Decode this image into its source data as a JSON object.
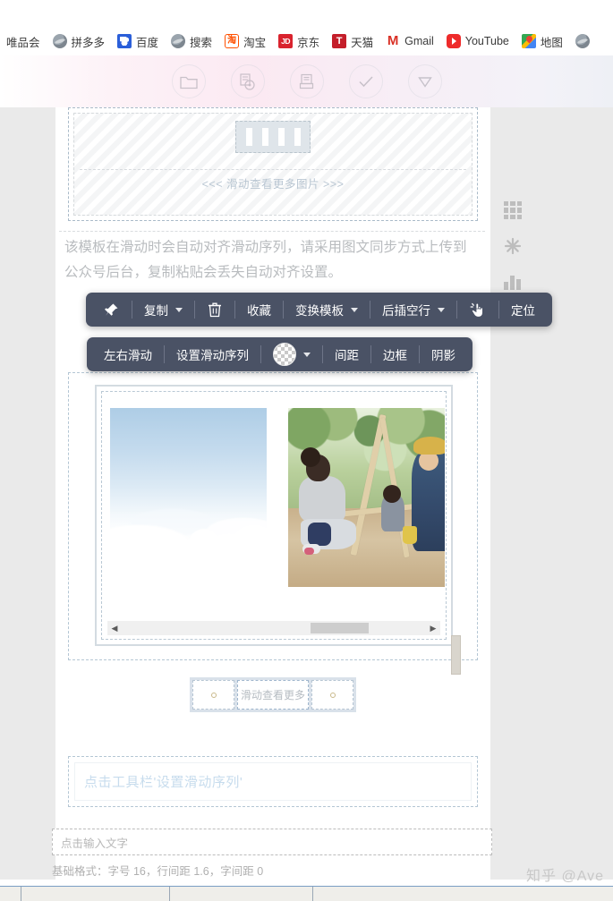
{
  "bookmarks": [
    {
      "label": "唯品会",
      "icon": "none"
    },
    {
      "label": "拼多多",
      "icon": "globe-icon"
    },
    {
      "label": "百度",
      "icon": "baidu-icon"
    },
    {
      "label": "搜索",
      "icon": "globe-icon"
    },
    {
      "label": "淘宝",
      "icon": "taobao-icon"
    },
    {
      "label": "京东",
      "icon": "jd-icon"
    },
    {
      "label": "天猫",
      "icon": "tmall-icon"
    },
    {
      "label": "Gmail",
      "icon": "gmail-icon"
    },
    {
      "label": "YouTube",
      "icon": "youtube-icon"
    },
    {
      "label": "地图",
      "icon": "maps-icon"
    }
  ],
  "faded_toolbar": {
    "icons": [
      "folder-icon",
      "media-disc-icon",
      "print-icon",
      "check-circle-icon",
      "chevron-down-circle-icon"
    ]
  },
  "canvas": {
    "placeholder": {
      "filmstrip_icon": "filmstrip-icon",
      "hint": "<<< 滑动查看更多图片 >>>"
    },
    "description": "该模板在滑动时会自动对齐滑动序列，请采用图文同步方式上传到公众号后台，复制粘贴会丢失自动对齐设置。",
    "slider": {
      "slides": [
        {
          "alt": "云海天空图片"
        },
        {
          "alt": "孩子们在树下搭竹架玩耍"
        }
      ],
      "scroll_left_glyph": "◀",
      "scroll_right_glyph": "▶"
    },
    "dots_row": {
      "left_dot": "•",
      "middle_label": "滑动查看更多",
      "right_dot": "•"
    },
    "hint_box": {
      "text": "点击工具栏'设置滑动序列'",
      "color": "#c7dced"
    }
  },
  "text_input": {
    "placeholder": "点击输入文字",
    "value": ""
  },
  "base_format": "基础格式：字号 16，行间距 1.6，字间距 0",
  "toolbar_primary": {
    "items": [
      {
        "type": "icon",
        "name": "pin-icon",
        "label": ""
      },
      {
        "type": "menu",
        "name": "copy",
        "label": "复制",
        "caret": true
      },
      {
        "type": "icon",
        "name": "trash-icon",
        "label": ""
      },
      {
        "type": "button",
        "name": "favorite",
        "label": "收藏",
        "caret": false
      },
      {
        "type": "menu",
        "name": "change-template",
        "label": "变换模板",
        "caret": true
      },
      {
        "type": "menu",
        "name": "insert-blank-line",
        "label": "后插空行",
        "caret": true
      },
      {
        "type": "icon",
        "name": "click-hand-icon",
        "label": ""
      },
      {
        "type": "button",
        "name": "locate",
        "label": "定位",
        "caret": false
      }
    ]
  },
  "toolbar_secondary": {
    "items": [
      {
        "type": "button",
        "name": "slide-horizontal",
        "label": "左右滑动",
        "caret": false
      },
      {
        "type": "button",
        "name": "set-slide-sequence",
        "label": "设置滑动序列",
        "caret": false
      },
      {
        "type": "swatch",
        "name": "color-swatch",
        "label": "",
        "caret": true
      },
      {
        "type": "button",
        "name": "spacing",
        "label": "间距",
        "caret": false
      },
      {
        "type": "button",
        "name": "border",
        "label": "边框",
        "caret": false
      },
      {
        "type": "button",
        "name": "shadow",
        "label": "阴影",
        "caret": false
      }
    ]
  },
  "rail": [
    {
      "name": "grid-icon"
    },
    {
      "name": "snowflake-icon"
    },
    {
      "name": "bar-chart-icon"
    }
  ],
  "watermark": "知乎 @Ave",
  "colors": {
    "toolbar_bg": "#4a5265",
    "hint_text": "#c7dced",
    "canvas_bg": "#ffffff",
    "gutter_bg": "#eaeaea"
  }
}
